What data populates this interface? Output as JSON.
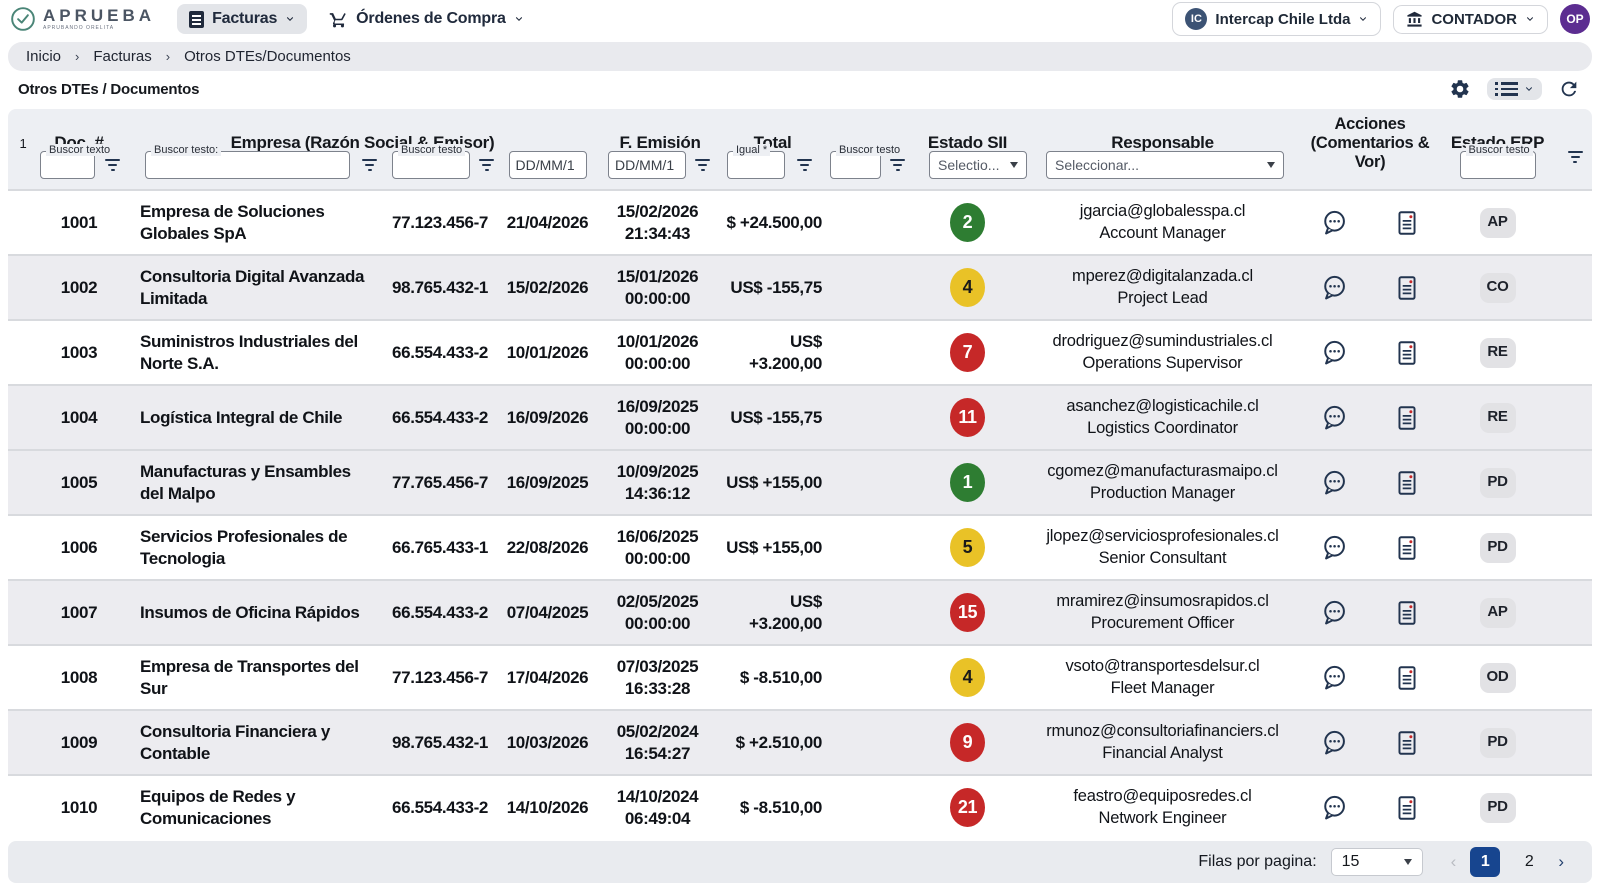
{
  "colors": {
    "green": "#2e7d32",
    "yellow": "#e9c227",
    "red": "#c62828",
    "green_text": "#ffffff",
    "yellow_text": "#1a1a1a",
    "red_text": "#ffffff",
    "accent_blue": "#17458f",
    "icon_navy": "#22344f",
    "avatar_purple": "#5c2d91",
    "logo_teal": "#4a8577"
  },
  "topbar": {
    "logo": {
      "name": "APRUEBA",
      "tagline": "APRUBANDO ORELITA"
    },
    "nav": {
      "facturas": "Facturas",
      "ordenes": "Órdenes de Compra"
    },
    "company": {
      "badge": "IC",
      "label": "Intercap Chile Ltda"
    },
    "role": {
      "label": "CONTADOR"
    },
    "avatar": "OP"
  },
  "breadcrumb": {
    "items": [
      "Inicio",
      "Facturas",
      "Otros DTEs/Documentos"
    ],
    "sep": "›"
  },
  "page": {
    "title": "Otros DTEs / Documentos"
  },
  "table": {
    "index_label": "1",
    "headers": {
      "doc": "Doc. #",
      "empresa": "Empresa (Razón Social & Emisor)",
      "emision": "F. Emisión",
      "total": "Total",
      "estado_sii": "Estado SII",
      "responsable": "Responsable",
      "acciones_l1": "Acciones",
      "acciones_l2": "(Comentarios & Vor)",
      "estado_erp": "Estado ERP"
    },
    "filters": {
      "doc_label": "Buscor texto",
      "empresa_label": "Buscor testo:",
      "emisor_label": "Buscor testo",
      "date1_placeholder": "DD/MM/1",
      "date2_placeholder": "DD/MM/1",
      "total_label": "Igual *",
      "extra_label": "Buscor testo",
      "estado_sii_placeholder": "Selectio...",
      "responsable_placeholder": "Seleccionar...",
      "estado_erp_label": "Buscor testo"
    },
    "rows": [
      {
        "doc": "1001",
        "empresa": "Empresa de Soluciones Globales SpA",
        "rut": "77.123.456-7",
        "fecha1": "21/04/2026",
        "fecha2": "15/02/2026",
        "hora": "21:34:43",
        "total": "$ +24.500,00",
        "sii": "2",
        "sii_color": "green",
        "email": "jgarcia@globalesspa.cl",
        "role": "Account Manager",
        "erp": "AP",
        "shaded": false
      },
      {
        "doc": "1002",
        "empresa": "Consultoria Digital Avanzada Limitada",
        "rut": "98.765.432-1",
        "fecha1": "15/02/2026",
        "fecha2": "15/01/2026",
        "hora": "00:00:00",
        "total": "US$ -155,75",
        "sii": "4",
        "sii_color": "yellow",
        "email": "mperez@digitalanzada.cl",
        "role": "Project Lead",
        "erp": "CO",
        "shaded": true
      },
      {
        "doc": "1003",
        "empresa": "Suministros Industriales del Norte S.A.",
        "rut": "66.554.433-2",
        "fecha1": "10/01/2026",
        "fecha2": "10/01/2026",
        "hora": "00:00:00",
        "total": "US$ +3.200,00",
        "sii": "7",
        "sii_color": "red",
        "email": "drodriguez@sumindustriales.cl",
        "role": "Operations Supervisor",
        "erp": "RE",
        "shaded": false
      },
      {
        "doc": "1004",
        "empresa": "Logística Integral de Chile",
        "rut": "66.554.433-2",
        "fecha1": "16/09/2026",
        "fecha2": "16/09/2025",
        "hora": "00:00:00",
        "total": "US$ -155,75",
        "sii": "11",
        "sii_color": "red",
        "email": "asanchez@logisticachile.cl",
        "role": "Logistics Coordinator",
        "erp": "RE",
        "shaded": true
      },
      {
        "doc": "1005",
        "empresa": "Manufacturas y Ensambles del Malpo",
        "rut": "77.765.456-7",
        "fecha1": "16/09/2025",
        "fecha2": "10/09/2025",
        "hora": "14:36:12",
        "total": "US$ +155,00",
        "sii": "1",
        "sii_color": "green",
        "email": "cgomez@manufacturasmaipo.cl",
        "role": "Production Manager",
        "erp": "PD",
        "shaded": true
      },
      {
        "doc": "1006",
        "empresa": "Servicios Profesionales de Tecnologia",
        "rut": "66.765.433-1",
        "fecha1": "22/08/2026",
        "fecha2": "16/06/2025",
        "hora": "00:00:00",
        "total": "US$ +155,00",
        "sii": "5",
        "sii_color": "yellow",
        "email": "jlopez@serviciosprofesionales.cl",
        "role": "Senior Consultant",
        "erp": "PD",
        "shaded": false
      },
      {
        "doc": "1007",
        "empresa": "Insumos de Oficina Rápidos",
        "rut": "66.554.433-2",
        "fecha1": "07/04/2025",
        "fecha2": "02/05/2025",
        "hora": "00:00:00",
        "total": "US$ +3.200,00",
        "sii": "15",
        "sii_color": "red",
        "email": "mramirez@insumosrapidos.cl",
        "role": "Procurement Officer",
        "erp": "AP",
        "shaded": true
      },
      {
        "doc": "1008",
        "empresa": "Empresa de Transportes del Sur",
        "rut": "77.123.456-7",
        "fecha1": "17/04/2026",
        "fecha2": "07/03/2025",
        "hora": "16:33:28",
        "total": "$ -8.510,00",
        "sii": "4",
        "sii_color": "yellow",
        "email": "vsoto@transportesdelsur.cl",
        "role": "Fleet Manager",
        "erp": "OD",
        "shaded": false
      },
      {
        "doc": "1009",
        "empresa": "Consultoria Financiera y Contable",
        "rut": "98.765.432-1",
        "fecha1": "10/03/2026",
        "fecha2": "05/02/2024",
        "hora": "16:54:27",
        "total": "$ +2.510,00",
        "sii": "9",
        "sii_color": "red",
        "email": "rmunoz@consultoriafinanciers.cl",
        "role": "Financial Analyst",
        "erp": "PD",
        "shaded": true
      },
      {
        "doc": "1010",
        "empresa": "Equipos de Redes y Comunicaciones",
        "rut": "66.554.433-2",
        "fecha1": "14/10/2026",
        "fecha2": "14/10/2024",
        "hora": "06:49:04",
        "total": "$ -8.510,00",
        "sii": "21",
        "sii_color": "red",
        "email": "feastro@equiposredes.cl",
        "role": "Network Engineer",
        "erp": "PD",
        "shaded": false
      }
    ]
  },
  "footer": {
    "rows_per_page_label": "Filas por pagina:",
    "rows_per_page": "15",
    "pages": [
      "1",
      "2"
    ],
    "prev": "‹",
    "next": "›"
  }
}
